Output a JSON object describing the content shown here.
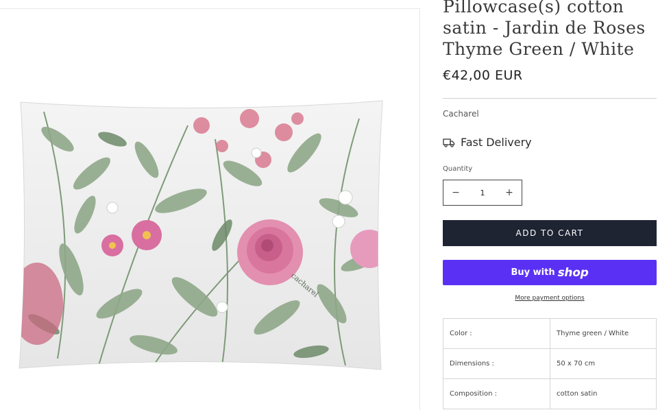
{
  "product": {
    "title": "Pillowcase(s) cotton satin - Jardin de Roses Thyme Green / White",
    "price": "€42,00 EUR",
    "vendor": "Cacharel",
    "delivery_label": "Fast Delivery",
    "image_brand_mark": "cacharel"
  },
  "quantity": {
    "label": "Quantity",
    "value": "1",
    "decrease_symbol": "−",
    "increase_symbol": "+"
  },
  "buttons": {
    "add_to_cart": "ADD TO CART",
    "buy_with": "Buy with",
    "shop_logo": "shop",
    "more_payment": "More payment options"
  },
  "specs": [
    {
      "label": "Color :",
      "value": "Thyme green / White"
    },
    {
      "label": "Dimensions :",
      "value": "50 x 70 cm"
    },
    {
      "label": "Composition :",
      "value": "cotton satin"
    }
  ],
  "colors": {
    "add_to_cart_bg": "#1f2433",
    "shop_pay_bg": "#5a31f4",
    "leaf_green": "#8fa88a",
    "rose_pink": "#d9769e"
  },
  "icons": [
    "truck-icon",
    "minus-icon",
    "plus-icon"
  ]
}
